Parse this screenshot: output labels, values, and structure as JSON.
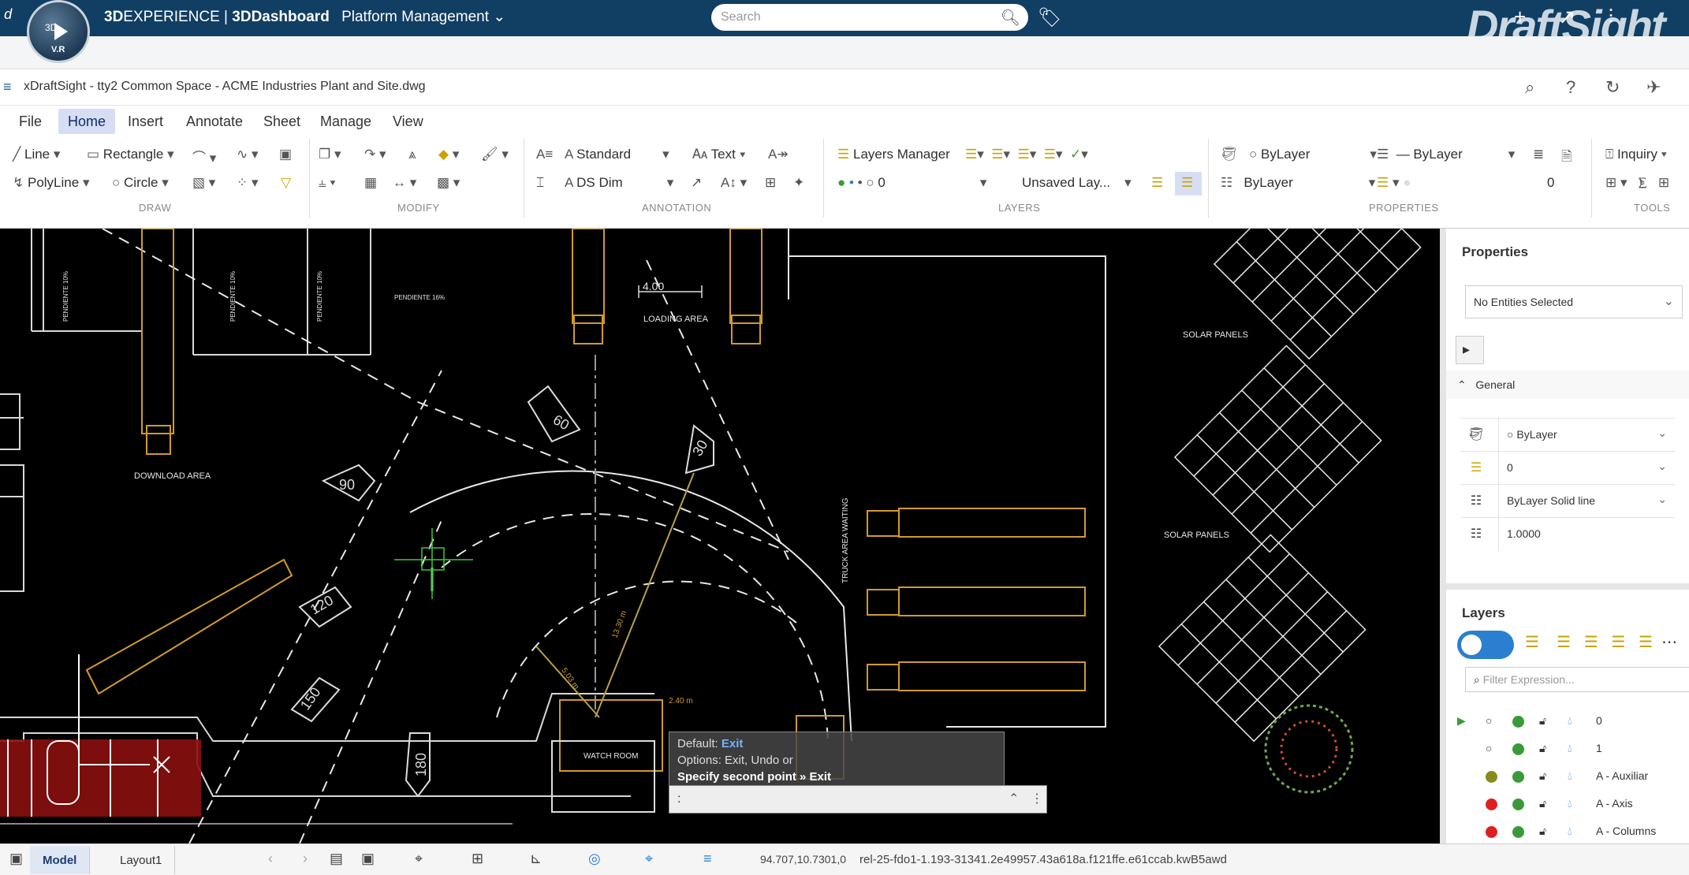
{
  "topbar": {
    "brand_bold": "3D",
    "brand_rest": "EXPERIENCE | ",
    "brand_dash": "3DDashboard",
    "brand_context": "Platform Management",
    "compass_label": "3D",
    "compass_sub": "V.R",
    "search_placeholder": "Search",
    "app_logo": "DraftSight"
  },
  "titlebar": {
    "title": "xDraftSight - tty2 Common Space - ACME Industries Plant and Site.dwg"
  },
  "menu": [
    "File",
    "Home",
    "Insert",
    "Annotate",
    "Sheet",
    "Manage",
    "View"
  ],
  "ribbon": {
    "draw": {
      "line": "Line",
      "rectangle": "Rectangle",
      "polyline": "PolyLine",
      "circle": "Circle",
      "group": "DRAW"
    },
    "modify": {
      "group": "MODIFY"
    },
    "annotation": {
      "text_style": "Standard",
      "text": "Text",
      "dim_style": "DS Dim",
      "group": "ANNOTATION"
    },
    "layers": {
      "manager": "Layers Manager",
      "current_layer": "0",
      "layer_state": "Unsaved Lay...",
      "group": "LAYERS"
    },
    "properties": {
      "color": "ByLayer",
      "linetype": "ByLayer",
      "lineweight": "ByLayer",
      "value": "0",
      "group": "PROPERTIES"
    },
    "tools": {
      "inquiry": "Inquiry",
      "group": "TOOLS"
    }
  },
  "drawing": {
    "labels": {
      "solar1": "SOLAR PANELS",
      "solar2": "SOLAR PANELS",
      "download": "DOWNLOAD AREA",
      "loading": "LOADING AREA",
      "truck_waiting": "TRUCK AREA WAITING",
      "watch_room": "WATCH ROOM",
      "dim_400": "4.00",
      "pend1": "PENDIENTE 16%",
      "pend2": "PENDIENTE 10%",
      "pend3": "PENDIENTE 10%",
      "pend4": "PENDIENTE 10%",
      "dim_240": "2.40 m",
      "dim_503": "5.03 m",
      "dim_1330": "13.30 m"
    },
    "arrows": [
      "60",
      "30",
      "90",
      "120",
      "150",
      "180"
    ]
  },
  "command_popup": {
    "line1_label": "Default: ",
    "line1_value": "Exit",
    "line2": "Options: Exit, Undo or",
    "line3": "Specify second point » Exit",
    "prompt": ":"
  },
  "properties_panel": {
    "title": "Properties",
    "selection": "No Entities Selected",
    "section": "General",
    "rows": [
      {
        "icon": "color-icon",
        "value": "ByLayer"
      },
      {
        "icon": "layer-icon",
        "value": "0"
      },
      {
        "icon": "linetype-icon",
        "value": "ByLayer  Solid line"
      },
      {
        "icon": "scale-icon",
        "value": "1.0000"
      }
    ]
  },
  "layers_panel": {
    "title": "Layers",
    "filter_placeholder": "Filter Expression...",
    "rows": [
      {
        "name": "0",
        "color": "#2f2f2f"
      },
      {
        "name": "1",
        "color": "#2f2f2f"
      },
      {
        "name": "A - Auxiliar",
        "color": "#8a8a1a"
      },
      {
        "name": "A - Axis",
        "color": "#e02020"
      },
      {
        "name": "A - Columns",
        "color": "#e02020"
      }
    ]
  },
  "statusbar": {
    "model_tab": "Model",
    "layout_tab": "Layout1",
    "coords": "94.707,10.7301,0",
    "hash": "rel-25-fdo1-1.193-31341.2e49957.43a618a.f121ffe.e61ccab.kwB5awd"
  }
}
